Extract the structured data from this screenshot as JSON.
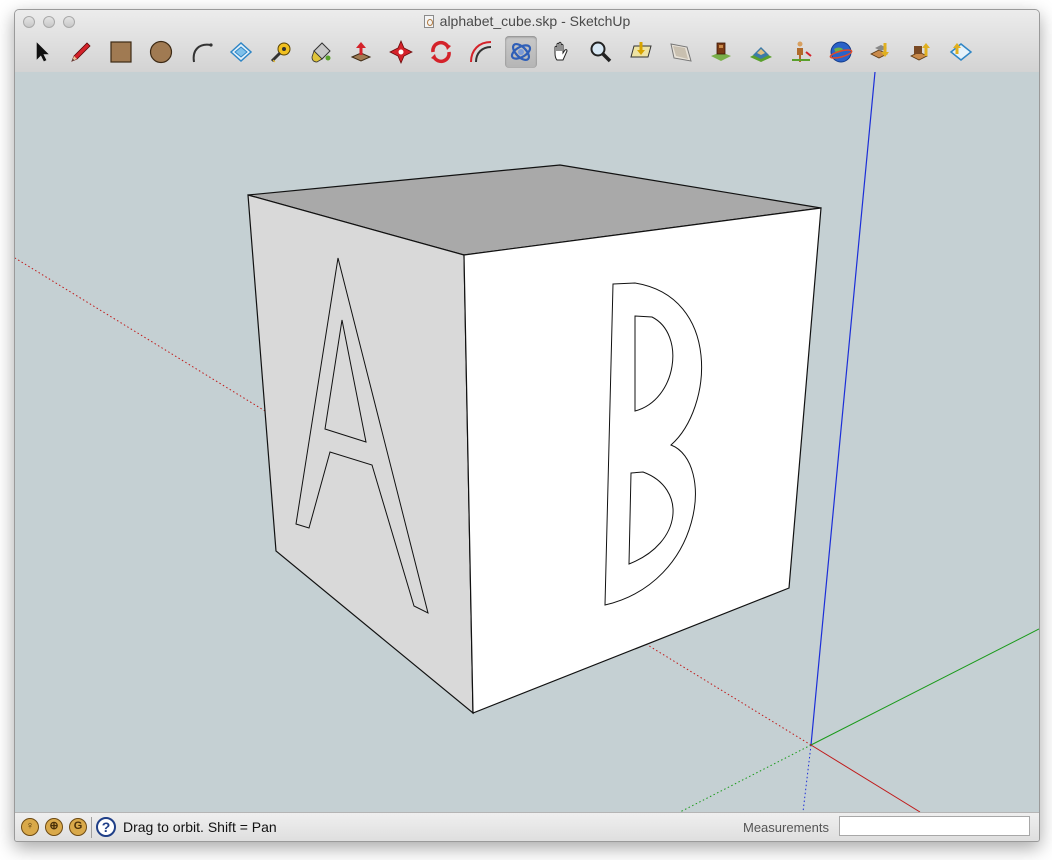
{
  "window": {
    "title": "alphabet_cube.skp - SketchUp"
  },
  "toolbar": {
    "tools": [
      {
        "name": "select-tool",
        "icon": "arrow-cursor-icon"
      },
      {
        "name": "line-tool",
        "icon": "pencil-icon"
      },
      {
        "name": "rectangle-tool",
        "icon": "rectangle-icon"
      },
      {
        "name": "circle-tool",
        "icon": "circle-icon"
      },
      {
        "name": "arc-tool",
        "icon": "arc-icon"
      },
      {
        "name": "make-component-tool",
        "icon": "component-icon"
      },
      {
        "name": "tape-measure-tool",
        "icon": "tape-measure-icon"
      },
      {
        "name": "paint-bucket-tool",
        "icon": "paint-bucket-icon"
      },
      {
        "name": "push-pull-tool",
        "icon": "push-pull-icon"
      },
      {
        "name": "move-tool",
        "icon": "move-icon"
      },
      {
        "name": "rotate-tool",
        "icon": "rotate-icon"
      },
      {
        "name": "offset-tool",
        "icon": "offset-icon"
      },
      {
        "name": "orbit-tool",
        "icon": "orbit-icon"
      },
      {
        "name": "pan-tool",
        "icon": "hand-icon"
      },
      {
        "name": "zoom-tool",
        "icon": "magnifier-icon"
      },
      {
        "name": "zoom-extents-tool",
        "icon": "zoom-extents-icon"
      },
      {
        "name": "previous-view-tool",
        "icon": "previous-view-icon"
      },
      {
        "name": "add-location-tool",
        "icon": "location-icon"
      },
      {
        "name": "toggle-terrain-tool",
        "icon": "terrain-icon"
      },
      {
        "name": "add-model-tool",
        "icon": "figure-icon"
      },
      {
        "name": "google-earth-tool",
        "icon": "globe-icon"
      },
      {
        "name": "get-models-tool",
        "icon": "get-models-icon"
      },
      {
        "name": "share-model-tool",
        "icon": "share-model-icon"
      },
      {
        "name": "share-component-tool",
        "icon": "share-component-icon"
      },
      {
        "name": "extension-warehouse-tool",
        "icon": "extension-icon"
      }
    ],
    "active": "orbit-tool"
  },
  "status": {
    "hint": "Drag to orbit.  Shift = Pan",
    "indicators": [
      "geo-location-icon",
      "credits-icon",
      "google-signin-icon"
    ]
  },
  "measurements": {
    "label": "Measurements",
    "value": ""
  },
  "colors": {
    "background": "#c5d0d3",
    "blue_axis": "#1c2ed8",
    "green_axis": "#1a9a1a",
    "red_axis": "#c01a1a",
    "cube_top": "#a9a9a9",
    "cube_left": "#d9d9d9",
    "cube_right": "#ffffff"
  }
}
